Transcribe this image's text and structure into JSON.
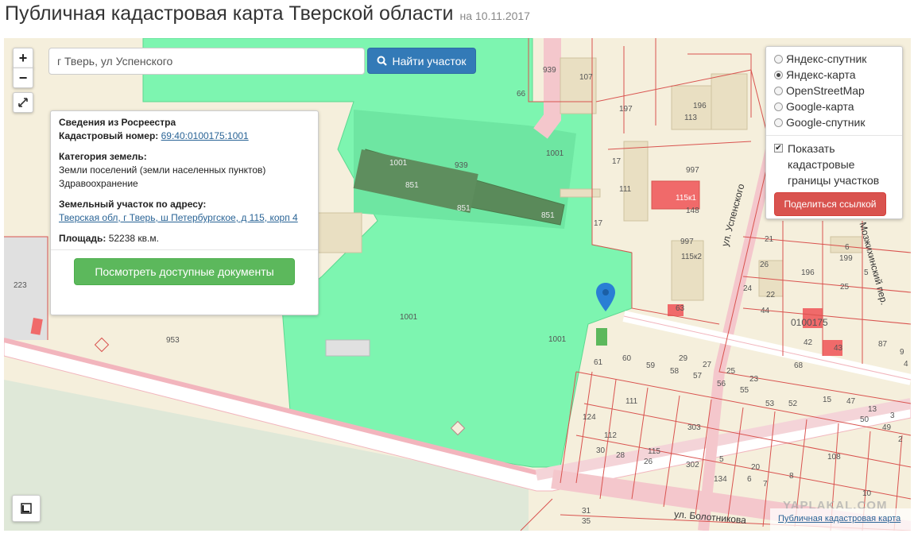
{
  "header": {
    "title": "Публичная кадастровая карта Тверской области",
    "date": "на 10.11.2017"
  },
  "search": {
    "value": "г Тверь, ул Успенского",
    "button_label": "Найти участок"
  },
  "zoom": {
    "in_label": "+",
    "out_label": "−"
  },
  "info": {
    "heading": "Сведения из Росреестра",
    "cadastral_label": "Кадастровый номер:",
    "cadastral_number": "69:40:0100175:1001",
    "category_label": "Категория земель:",
    "category_line1": "Земли поселений (земли населенных пунктов)",
    "category_line2": "Здравоохранение",
    "address_label": "Земельный участок по адресу:",
    "address": "Тверская обл, г Тверь, ш Петербургское, д 115, корп 4",
    "area_label": "Площадь:",
    "area_value": "52238 кв.м.",
    "docs_button": "Посмотреть доступные документы"
  },
  "layers": {
    "options": [
      {
        "label": "Яндекс-спутник",
        "selected": false
      },
      {
        "label": "Яндекс-карта",
        "selected": true
      },
      {
        "label": "OpenStreetMap",
        "selected": false
      },
      {
        "label": "Google-карта",
        "selected": false
      },
      {
        "label": "Google-спутник",
        "selected": false
      }
    ],
    "show_borders_label": "Показать кадастровые границы участков",
    "show_borders_checked": true,
    "share_button": "Поделиться ссылкой"
  },
  "map": {
    "labels": [
      "939",
      "66",
      "107",
      "197",
      "196",
      "113",
      "1001",
      "939",
      "1001",
      "851",
      "851",
      "851",
      "17",
      "111",
      "997",
      "115к1",
      "148",
      "17",
      "997",
      "115к2",
      "21",
      "26",
      "199",
      "6",
      "196",
      "5",
      "25",
      "24",
      "22",
      "63",
      "44",
      "0100175",
      "1001",
      "1001",
      "1001",
      "953",
      "223",
      "61",
      "60",
      "59",
      "58",
      "57",
      "29",
      "27",
      "56",
      "25",
      "55",
      "23",
      "68",
      "111",
      "53",
      "15",
      "13",
      "124",
      "112",
      "115",
      "26",
      "28",
      "30",
      "303",
      "302",
      "5",
      "6",
      "20",
      "134",
      "7",
      "108",
      "8",
      "10",
      "35",
      "31",
      "42",
      "43",
      "47",
      "50",
      "87",
      "4",
      "9",
      "52",
      "49",
      "3",
      "2"
    ],
    "streets": [
      "ул. Успенского",
      "ул. Болотникова",
      "Мозжихинский пер."
    ],
    "colors": {
      "parcel_green": "#7df5b0",
      "building_green": "#5a8a5a",
      "road_pink": "#f4c7cc",
      "land": "#f5efdc",
      "parcel_line": "#d9534f"
    }
  },
  "attribution": {
    "watermark": "YAPLAKAL.COM",
    "link": "Публичная кадастровая карта",
    "copyright": "© Я"
  }
}
